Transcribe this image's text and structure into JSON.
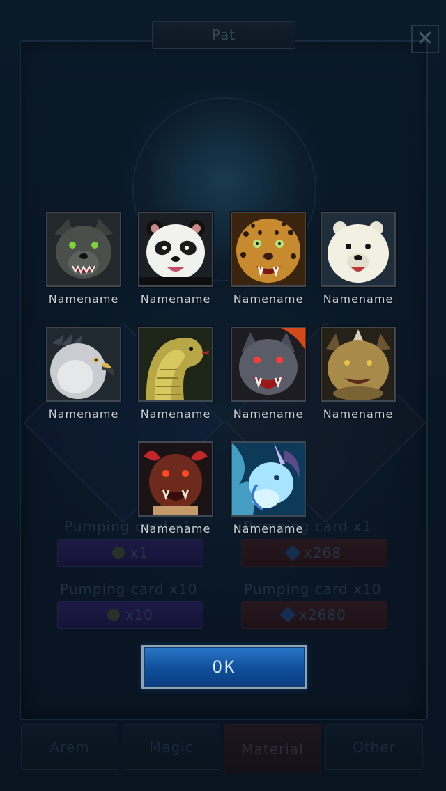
{
  "window": {
    "title": "Pat"
  },
  "background": {
    "pumping": [
      {
        "label": "Pumping card x1",
        "cost": "x1",
        "currency_icon": "coin-icon"
      },
      {
        "label": "Pumping card x1",
        "cost": "x268",
        "currency_icon": "gem-icon"
      },
      {
        "label": "Pumping card x10",
        "cost": "x10",
        "currency_icon": "coin-icon"
      },
      {
        "label": "Pumping card x10",
        "cost": "x2680",
        "currency_icon": "gem-icon"
      }
    ],
    "tabs": [
      {
        "label": "Arem"
      },
      {
        "label": "Magic"
      },
      {
        "label": "Material",
        "active": true
      },
      {
        "label": "Other"
      }
    ]
  },
  "pets": [
    {
      "name": "Namename",
      "animal": "wolf"
    },
    {
      "name": "Namename",
      "animal": "panda"
    },
    {
      "name": "Namename",
      "animal": "leopard"
    },
    {
      "name": "Namename",
      "animal": "polar-bear"
    },
    {
      "name": "Namename",
      "animal": "eagle"
    },
    {
      "name": "Namename",
      "animal": "cobra"
    },
    {
      "name": "Namename",
      "animal": "demon-wolf"
    },
    {
      "name": "Namename",
      "animal": "dragon-beast"
    },
    {
      "name": "Namename",
      "animal": "red-dragon"
    },
    {
      "name": "Namename",
      "animal": "ice-unicorn"
    }
  ],
  "ok_button": {
    "label": "OK"
  },
  "colors": {
    "accent": "#1b64b4",
    "frame": "#3e4752",
    "name_text": "#c9d2da"
  }
}
